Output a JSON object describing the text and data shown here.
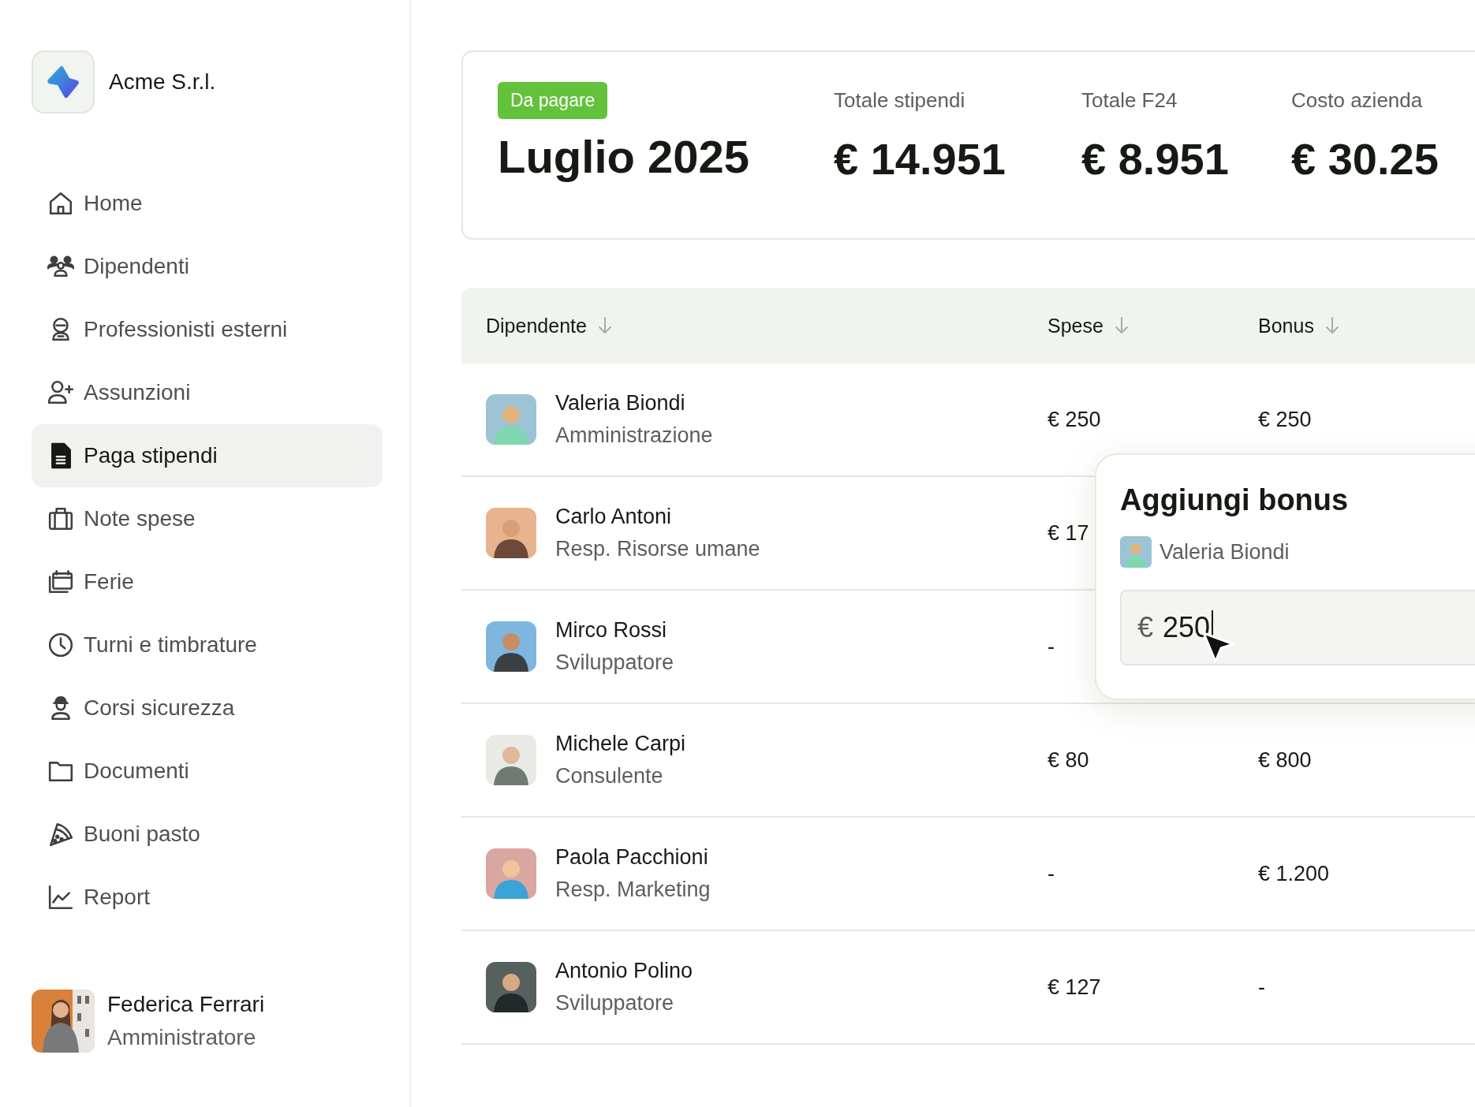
{
  "company": {
    "name": "Acme S.r.l."
  },
  "nav": [
    {
      "label": "Home",
      "selected": false
    },
    {
      "label": "Dipendenti",
      "selected": false
    },
    {
      "label": "Professionisti esterni",
      "selected": false
    },
    {
      "label": "Assunzioni",
      "selected": false
    },
    {
      "label": "Paga stipendi",
      "selected": true
    },
    {
      "label": "Note spese",
      "selected": false
    },
    {
      "label": "Ferie",
      "selected": false
    },
    {
      "label": "Turni e timbrature",
      "selected": false
    },
    {
      "label": "Corsi sicurezza",
      "selected": false
    },
    {
      "label": "Documenti",
      "selected": false
    },
    {
      "label": "Buoni pasto",
      "selected": false
    },
    {
      "label": "Report",
      "selected": false
    }
  ],
  "user": {
    "name": "Federica Ferrari",
    "role": "Amministratore"
  },
  "summary": {
    "badge": "Da pagare",
    "period": "Luglio 2025",
    "stats": [
      {
        "label": "Totale stipendi",
        "value": "€ 14.951"
      },
      {
        "label": "Totale F24",
        "value": "€ 8.951"
      },
      {
        "label": "Costo azienda",
        "value": "€ 30.25"
      }
    ]
  },
  "table": {
    "columns": [
      "Dipendente",
      "Spese",
      "Bonus"
    ],
    "rows": [
      {
        "name": "Valeria Biondi",
        "role": "Amministrazione",
        "spese": "€ 250",
        "bonus": "€ 250"
      },
      {
        "name": "Carlo Antoni",
        "role": "Resp. Risorse umane",
        "spese": "€ 17"
      },
      {
        "name": "Mirco Rossi",
        "role": "Sviluppatore",
        "spese": "-"
      },
      {
        "name": "Michele Carpi",
        "role": "Consulente",
        "spese": "€ 80",
        "bonus": "€ 800"
      },
      {
        "name": "Paola Pacchioni",
        "role": "Resp. Marketing",
        "spese": "-",
        "bonus": "€ 1.200"
      },
      {
        "name": "Antonio Polino",
        "role": "Sviluppatore",
        "spese": "€ 127",
        "bonus": "-"
      }
    ]
  },
  "popover": {
    "title": "Aggiungi bonus",
    "employee": "Valeria Biondi",
    "currency": "€",
    "value": "250"
  }
}
